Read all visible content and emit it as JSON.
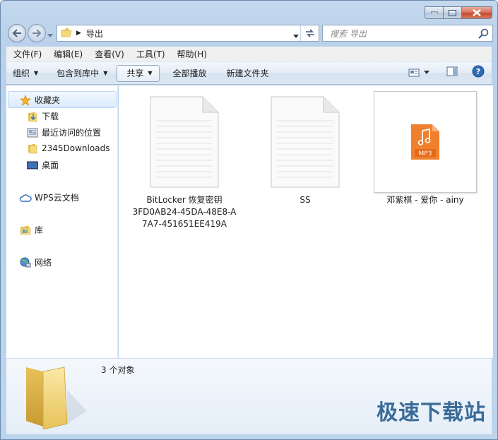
{
  "window": {
    "colors": {
      "frame": "#b9d1ea",
      "accent": "#3d7bc4",
      "close": "#c6452a"
    }
  },
  "nav": {
    "address_path": "导出",
    "search_placeholder": "搜索 导出"
  },
  "menu": {
    "items": [
      "文件(F)",
      "编辑(E)",
      "查看(V)",
      "工具(T)",
      "帮助(H)"
    ]
  },
  "commands": {
    "organize": "组织",
    "include_library": "包含到库中",
    "share": "共享",
    "play_all": "全部播放",
    "new_folder": "新建文件夹"
  },
  "sidebar": {
    "favorites": "收藏夹",
    "items": [
      "下载",
      "最近访问的位置",
      "2345Downloads",
      "桌面"
    ],
    "wps": "WPS云文档",
    "library": "库",
    "network": "网络"
  },
  "files": [
    {
      "name_lines": [
        "BitLocker 恢复密钥",
        "3FD0AB24-45DA-48E8-A",
        "7A7-451651EE419A"
      ],
      "icon": "text-file-icon"
    },
    {
      "name_lines": [
        "SS"
      ],
      "icon": "text-file-icon"
    },
    {
      "name_lines": [
        "邓紫棋 - 爱你 - ainy"
      ],
      "icon": "mp3-file-icon",
      "badge": "MP3"
    }
  ],
  "details": {
    "count": "3 个对象"
  },
  "watermark": "极速下载站"
}
